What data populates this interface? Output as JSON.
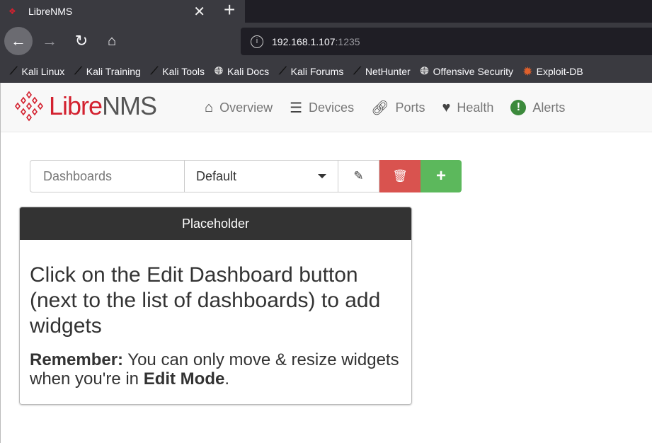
{
  "browser": {
    "tab_title": "LibreNMS",
    "url_host": "192.168.1.107",
    "url_port": ":1235",
    "bookmarks": [
      {
        "label": "Kali Linux",
        "icon": "kali-dragon-icon"
      },
      {
        "label": "Kali Training",
        "icon": "kali-dragon-icon"
      },
      {
        "label": "Kali Tools",
        "icon": "kali-dragon-icon"
      },
      {
        "label": "Kali Docs",
        "icon": "globe-icon"
      },
      {
        "label": "Kali Forums",
        "icon": "kali-dragon-icon"
      },
      {
        "label": "NetHunter",
        "icon": "kali-dragon-icon"
      },
      {
        "label": "Offensive Security",
        "icon": "globe-icon"
      },
      {
        "label": "Exploit-DB",
        "icon": "exploitdb-icon"
      }
    ]
  },
  "navbar": {
    "logo_libre": "Libre",
    "logo_nms": "NMS",
    "items": [
      {
        "label": "Overview",
        "icon": "home-icon"
      },
      {
        "label": "Devices",
        "icon": "server-icon"
      },
      {
        "label": "Ports",
        "icon": "link-icon"
      },
      {
        "label": "Health",
        "icon": "heartbeat-icon"
      },
      {
        "label": "Alerts",
        "icon": "exclamation-circle-icon"
      }
    ]
  },
  "dashboard": {
    "label": "Dashboards",
    "selected": "Default"
  },
  "panel": {
    "title": "Placeholder",
    "heading": "Click on the Edit Dashboard button (next to the list of dashboards) to add widgets",
    "remember_label": "Remember:",
    "remember_text": " You can only move & resize widgets when you're in ",
    "edit_mode": "Edit Mode",
    "period": "."
  },
  "colors": {
    "brand": "#d3212f",
    "danger": "#d9534f",
    "success": "#5cb85c",
    "panel_header": "#333333"
  }
}
